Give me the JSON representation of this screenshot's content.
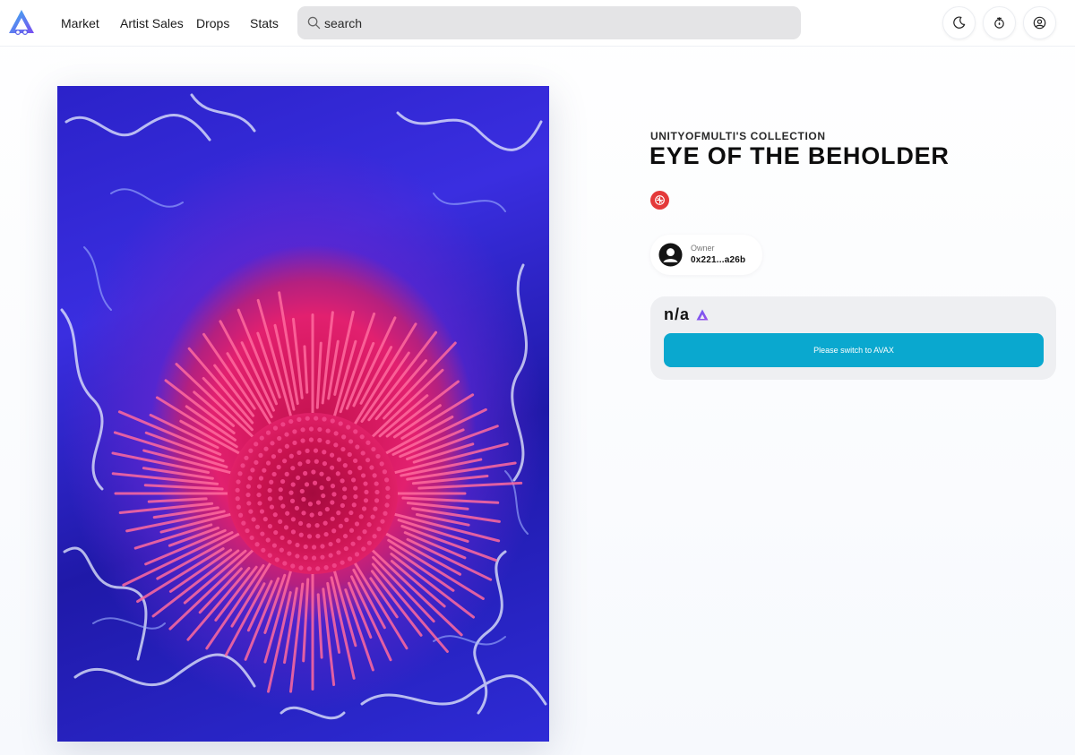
{
  "header": {
    "nav": [
      "Market",
      "Artist Sales",
      "Drops",
      "Stats"
    ],
    "search_placeholder": "search",
    "icons": {
      "logo": "avalanche-logo-icon",
      "search": "search-icon",
      "theme": "moon-icon",
      "faucet": "faucet-icon",
      "account": "user-circle-icon"
    }
  },
  "nft": {
    "collection": "UNITYOFMULTI'S COLLECTION",
    "title": "EYE OF THE BEHOLDER",
    "badge_icon": "network-badge-icon",
    "owner": {
      "label": "Owner",
      "address": "0x221...a26b"
    },
    "price": "n/a",
    "price_currency_icon": "avax-icon",
    "action_label": "Please switch to AVAX"
  },
  "colors": {
    "accent": "#0aa8cf",
    "badge": "#e43a3a",
    "panel": "#eeeff2"
  }
}
